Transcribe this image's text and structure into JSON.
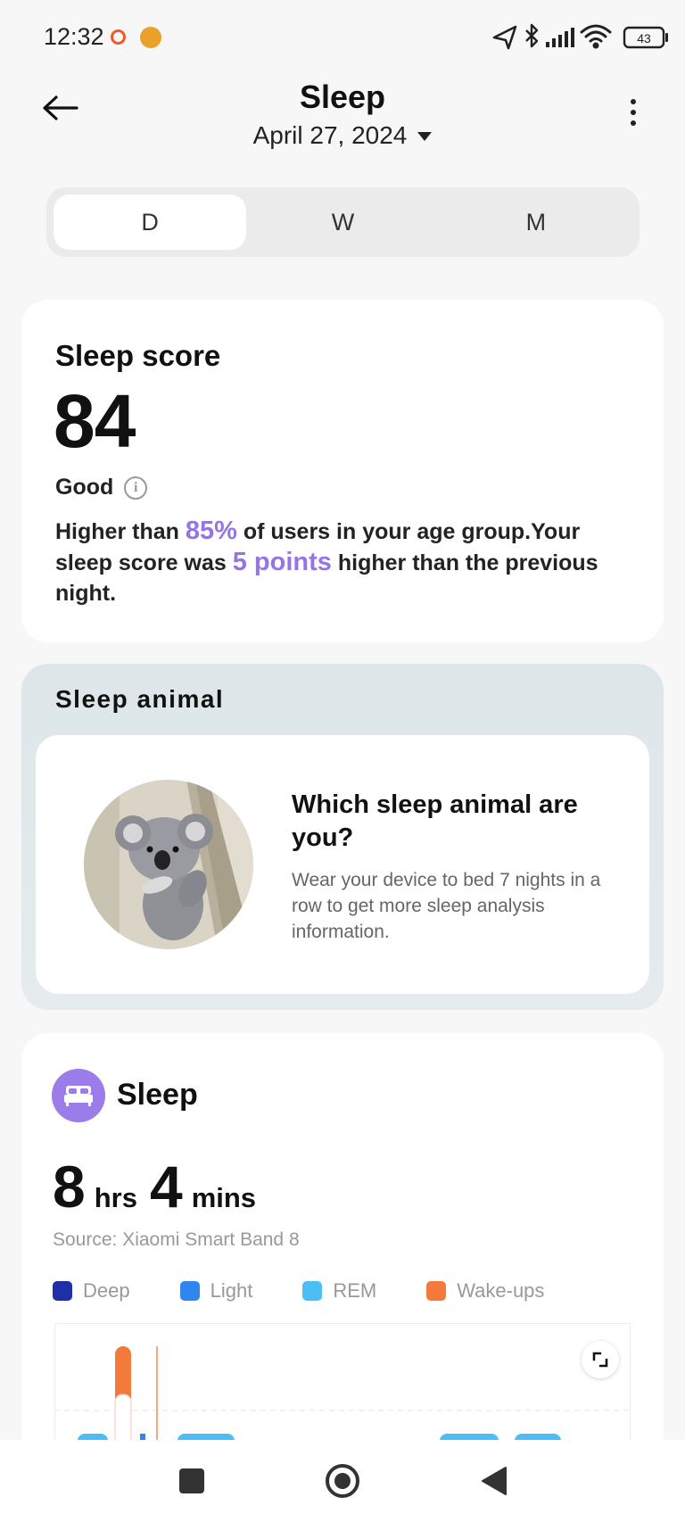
{
  "status_bar": {
    "time": "12:32",
    "battery": "43",
    "icons": [
      "record-dot-icon",
      "app-notification-icon",
      "location-arrow-icon",
      "bluetooth-icon",
      "signal-icon",
      "wifi-icon",
      "battery-icon"
    ]
  },
  "header": {
    "title": "Sleep",
    "date": "April 27, 2024"
  },
  "tabs": [
    {
      "label": "D",
      "active": true
    },
    {
      "label": "W",
      "active": false
    },
    {
      "label": "M",
      "active": false
    }
  ],
  "score_card": {
    "label": "Sleep score",
    "value": "84",
    "rating": "Good",
    "desc_part1": "Higher than ",
    "percent": "85%",
    "desc_part2": " of users in your age group.Your sleep score was ",
    "points": "5 points",
    "desc_part3": " higher than the previous night."
  },
  "sleep_animal": {
    "heading": "Sleep animal",
    "question": "Which sleep animal are you?",
    "info": "Wear your device to bed 7 nights in a row to get more sleep analysis information."
  },
  "sleep_card": {
    "heading": "Sleep",
    "hours": "8",
    "hours_unit": "hrs",
    "mins": "4",
    "mins_unit": "mins",
    "source": "Source: Xiaomi Smart Band 8",
    "legend": [
      {
        "label": "Deep",
        "color": "#1f2fa8"
      },
      {
        "label": "Light",
        "color": "#2f86f0"
      },
      {
        "label": "REM",
        "color": "#4cbef5"
      },
      {
        "label": "Wake-ups",
        "color": "#f47a3c"
      }
    ]
  },
  "colors": {
    "accent_purple": "#9575e6",
    "sleep_icon_bg": "#9c7ce8",
    "wake_orange": "#f47a3c",
    "rem_blue": "#4cbef5"
  },
  "navbar": {
    "icons": [
      "square-icon",
      "home-circle-icon",
      "back-triangle-icon"
    ]
  }
}
